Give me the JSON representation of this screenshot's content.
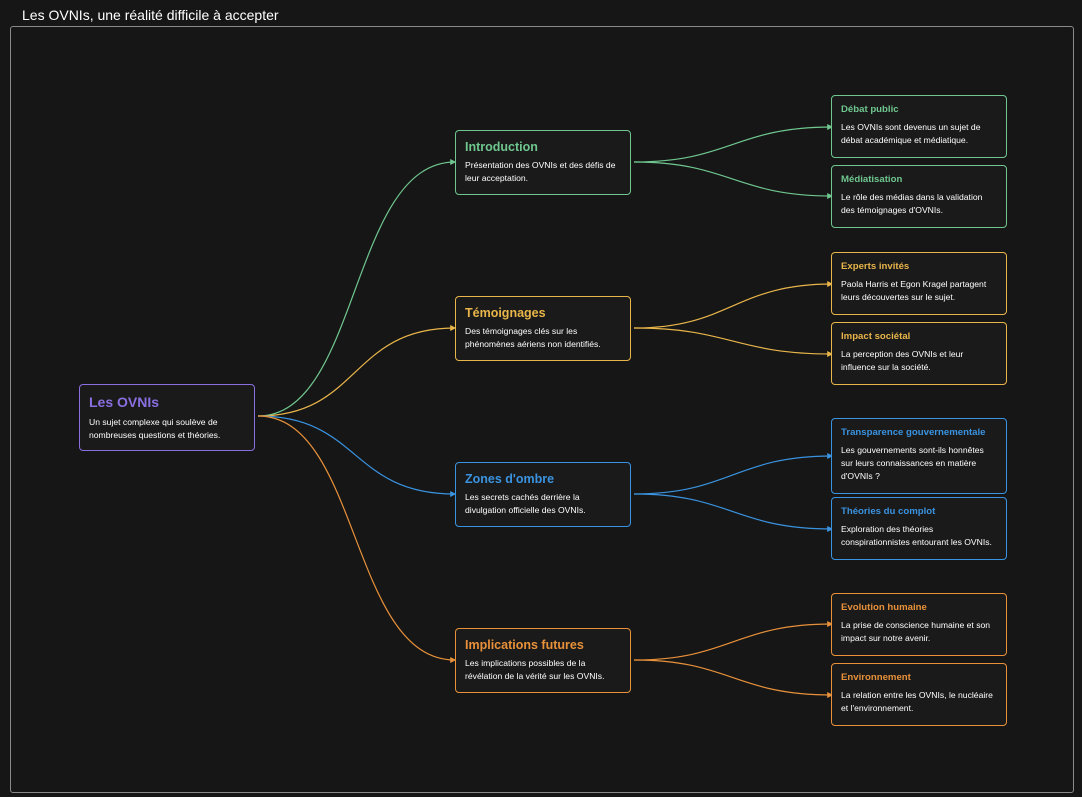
{
  "page": {
    "title": "Les OVNIs, une réalité difficile à accepter"
  },
  "colors": {
    "root": "#8a6fe0",
    "introduction": "#6fc78f",
    "temoignages": "#e8b54a",
    "zones": "#3a93e0",
    "implications": "#e8913a"
  },
  "root": {
    "title": "Les OVNIs",
    "desc": "Un sujet complexe qui soulève de nombreuses questions et théories."
  },
  "branches": [
    {
      "title": "Introduction",
      "desc": "Présentation des OVNIs et des défis de leur acceptation.",
      "children": [
        {
          "title": "Débat public",
          "desc": "Les OVNIs sont devenus un sujet de débat académique et médiatique."
        },
        {
          "title": "Médiatisation",
          "desc": "Le rôle des médias dans la validation des témoignages d'OVNIs."
        }
      ]
    },
    {
      "title": "Témoignages",
      "desc": "Des témoignages clés sur les phénomènes aériens non identifiés.",
      "children": [
        {
          "title": "Experts invités",
          "desc": "Paola Harris et Egon Kragel partagent leurs découvertes sur le sujet."
        },
        {
          "title": "Impact sociétal",
          "desc": "La perception des OVNIs et leur influence sur la société."
        }
      ]
    },
    {
      "title": "Zones d'ombre",
      "desc": "Les secrets cachés derrière la divulgation officielle des OVNIs.",
      "children": [
        {
          "title": "Transparence gouvernementale",
          "desc": "Les gouvernements sont-ils honnêtes sur leurs connaissances en matière d'OVNIs ?"
        },
        {
          "title": "Théories du complot",
          "desc": "Exploration des théories conspirationnistes entourant les OVNIs."
        }
      ]
    },
    {
      "title": "Implications futures",
      "desc": "Les implications possibles de la révélation de la vérité sur les OVNIs.",
      "children": [
        {
          "title": "Evolution humaine",
          "desc": "La prise de conscience humaine et son impact sur notre avenir."
        },
        {
          "title": "Environnement",
          "desc": "La relation entre les OVNIs, le nucléaire et l'environnement."
        }
      ]
    }
  ]
}
